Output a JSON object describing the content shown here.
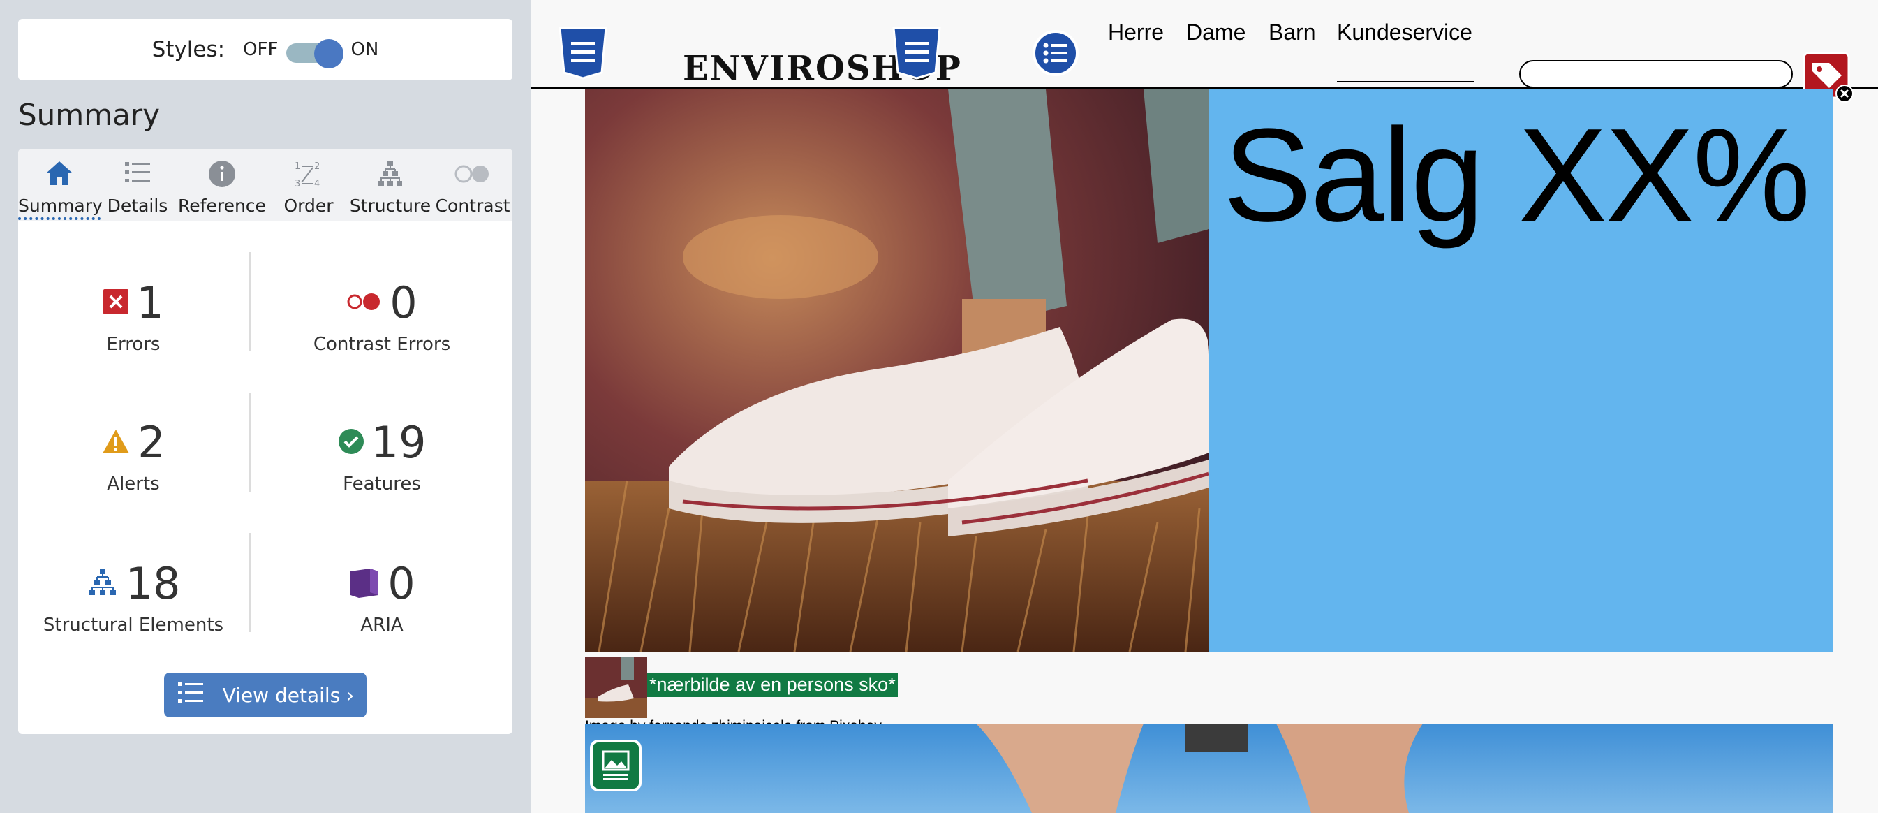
{
  "panel": {
    "styles_label": "Styles:",
    "toggle_off": "OFF",
    "toggle_on": "ON",
    "title": "Summary",
    "tabs": [
      {
        "label": "Summary",
        "icon": "home-icon"
      },
      {
        "label": "Details",
        "icon": "list-icon"
      },
      {
        "label": "Reference",
        "icon": "info-icon"
      },
      {
        "label": "Order",
        "icon": "order-icon"
      },
      {
        "label": "Structure",
        "icon": "structure-icon"
      },
      {
        "label": "Contrast",
        "icon": "contrast-icon"
      }
    ],
    "active_tab": "Summary",
    "stats": {
      "errors": {
        "value": "1",
        "label": "Errors"
      },
      "contrast_errors": {
        "value": "0",
        "label": "Contrast Errors"
      },
      "alerts": {
        "value": "2",
        "label": "Alerts"
      },
      "features": {
        "value": "19",
        "label": "Features"
      },
      "structural": {
        "value": "18",
        "label": "Structural Elements"
      },
      "aria": {
        "value": "0",
        "label": "ARIA"
      }
    },
    "view_details": "View details ›",
    "colors": {
      "error": "#c8282e",
      "alert": "#e09b1a",
      "feature": "#2e8b57",
      "structure": "#2a67b1",
      "aria": "#5b2f86",
      "button": "#4a7cc0"
    }
  },
  "site": {
    "logo": "ENVIROSHOP",
    "nav": [
      "Herre",
      "Dame",
      "Barn",
      "Kundeservice"
    ],
    "search": {
      "value": "",
      "placeholder": ""
    },
    "sale_text": "Salg XX%",
    "image_alt": "*nærbilde av en persons sko*",
    "credit": "Image by fernando zhiminaicela from Pixabay",
    "colors": {
      "sale_bg": "#63b5ee",
      "alt_bg": "#117a43"
    }
  }
}
